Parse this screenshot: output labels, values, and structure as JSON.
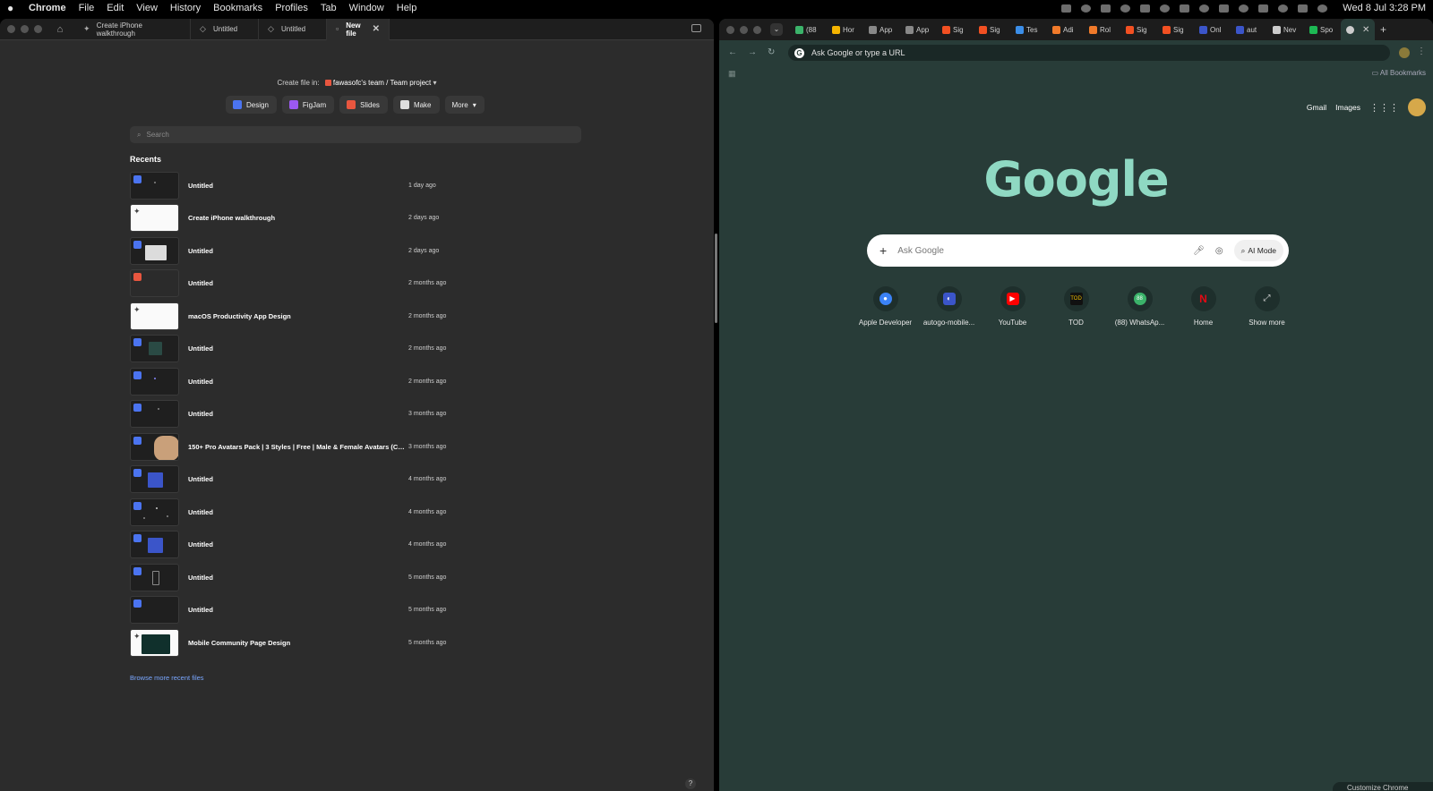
{
  "menubar": {
    "items": [
      "Chrome",
      "File",
      "Edit",
      "View",
      "History",
      "Bookmarks",
      "Profiles",
      "Tab",
      "Window",
      "Help"
    ],
    "clock": "Wed 8 Jul  3:28 PM"
  },
  "figma": {
    "tabs": [
      {
        "label": "Create iPhone walkthrough"
      },
      {
        "label": "Untitled"
      },
      {
        "label": "Untitled"
      },
      {
        "label": "New file"
      }
    ],
    "create_in_label": "Create file in:",
    "team": "fawasofc's team / Team project",
    "file_types": [
      {
        "label": "Design",
        "color": "#4b74f0"
      },
      {
        "label": "FigJam",
        "color": "#9b59f0"
      },
      {
        "label": "Slides",
        "color": "#e8563f"
      },
      {
        "label": "Make",
        "color": "#dddddd"
      },
      {
        "label": "More"
      }
    ],
    "search_placeholder": "Search",
    "recents_title": "Recents",
    "recents": [
      {
        "name": "Untitled",
        "date": "1 day ago"
      },
      {
        "name": "Create iPhone walkthrough",
        "date": "2 days ago"
      },
      {
        "name": "Untitled",
        "date": "2 days ago"
      },
      {
        "name": "Untitled",
        "date": "2 months ago"
      },
      {
        "name": "macOS Productivity App Design",
        "date": "2 months ago"
      },
      {
        "name": "Untitled",
        "date": "2 months ago"
      },
      {
        "name": "Untitled",
        "date": "2 months ago"
      },
      {
        "name": "Untitled",
        "date": "3 months ago"
      },
      {
        "name": "150+ Pro Avatars Pack | 3 Styles | Free | Male & Female Avatars (Com...",
        "date": "3 months ago"
      },
      {
        "name": "Untitled",
        "date": "4 months ago"
      },
      {
        "name": "Untitled",
        "date": "4 months ago"
      },
      {
        "name": "Untitled",
        "date": "4 months ago"
      },
      {
        "name": "Untitled",
        "date": "5 months ago"
      },
      {
        "name": "Untitled",
        "date": "5 months ago"
      },
      {
        "name": "Mobile Community Page Design",
        "date": "5 months ago"
      }
    ],
    "browse_more": "Browse more recent files",
    "help": "?"
  },
  "chrome": {
    "tabs": [
      {
        "label": "(88",
        "color": "#3bb36a"
      },
      {
        "label": "Hor",
        "color": "#f4b400"
      },
      {
        "label": "App",
        "color": "#888888"
      },
      {
        "label": "App",
        "color": "#888888"
      },
      {
        "label": "Sig",
        "color": "#f25022"
      },
      {
        "label": "Sig",
        "color": "#f25022"
      },
      {
        "label": "Tes",
        "color": "#3b8ee8"
      },
      {
        "label": "Adi",
        "color": "#f07a2a"
      },
      {
        "label": "Rol",
        "color": "#f07a2a"
      },
      {
        "label": "Sig",
        "color": "#f25022"
      },
      {
        "label": "Sig",
        "color": "#f25022"
      },
      {
        "label": "Onl",
        "color": "#3b55c9"
      },
      {
        "label": "aut",
        "color": "#3b55c9"
      },
      {
        "label": "Nev",
        "color": "#cccccc"
      },
      {
        "label": "Spo",
        "color": "#1db954"
      }
    ],
    "omnibox_placeholder": "Ask Google or type a URL",
    "all_bookmarks": "All Bookmarks",
    "links": {
      "gmail": "Gmail",
      "images": "Images"
    },
    "logo": "Google",
    "search_placeholder": "Ask Google",
    "ai_mode": "AI Mode",
    "shortcuts": [
      {
        "label": "Apple Developer",
        "color": "#3b82f6",
        "glyph": ""
      },
      {
        "label": "autogo-mobile...",
        "color": "#3b55c9",
        "glyph": "◐"
      },
      {
        "label": "YouTube",
        "color": "#ff0000",
        "glyph": "▶"
      },
      {
        "label": "TOD",
        "color": "#111111",
        "glyph": "TOD"
      },
      {
        "label": "(88) WhatsAp...",
        "color": "#3bb36a",
        "glyph": "88"
      },
      {
        "label": "Home",
        "color": "#000000",
        "glyph": "N"
      },
      {
        "label": "Show more",
        "color": "transparent",
        "glyph": "⤢"
      }
    ],
    "customize": "Customize Chrome"
  }
}
